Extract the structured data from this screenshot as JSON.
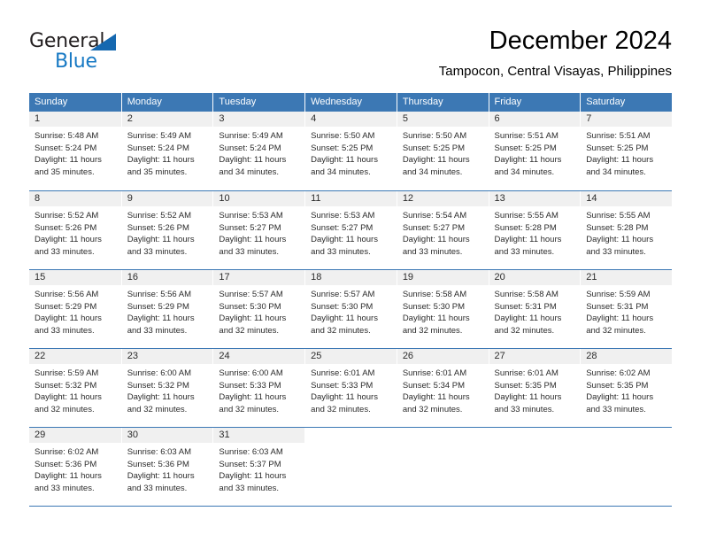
{
  "logo": {
    "text_top": "General",
    "text_bottom": "Blue",
    "triangle_color": "#1568b0",
    "blue_color": "#1779c4"
  },
  "header": {
    "title": "December 2024",
    "subtitle": "Tampocon, Central Visayas, Philippines"
  },
  "theme": {
    "header_bg": "#3c78b4",
    "header_text": "#ffffff",
    "daynum_band_bg": "#f0f0f0",
    "cell_bg": "#ffffff",
    "grid_line": "#3c78b4"
  },
  "weekdays": [
    "Sunday",
    "Monday",
    "Tuesday",
    "Wednesday",
    "Thursday",
    "Friday",
    "Saturday"
  ],
  "weeks": [
    {
      "days": [
        {
          "num": "1",
          "sunrise": "Sunrise: 5:48 AM",
          "sunset": "Sunset: 5:24 PM",
          "daylight": "Daylight: 11 hours and 35 minutes."
        },
        {
          "num": "2",
          "sunrise": "Sunrise: 5:49 AM",
          "sunset": "Sunset: 5:24 PM",
          "daylight": "Daylight: 11 hours and 35 minutes."
        },
        {
          "num": "3",
          "sunrise": "Sunrise: 5:49 AM",
          "sunset": "Sunset: 5:24 PM",
          "daylight": "Daylight: 11 hours and 34 minutes."
        },
        {
          "num": "4",
          "sunrise": "Sunrise: 5:50 AM",
          "sunset": "Sunset: 5:25 PM",
          "daylight": "Daylight: 11 hours and 34 minutes."
        },
        {
          "num": "5",
          "sunrise": "Sunrise: 5:50 AM",
          "sunset": "Sunset: 5:25 PM",
          "daylight": "Daylight: 11 hours and 34 minutes."
        },
        {
          "num": "6",
          "sunrise": "Sunrise: 5:51 AM",
          "sunset": "Sunset: 5:25 PM",
          "daylight": "Daylight: 11 hours and 34 minutes."
        },
        {
          "num": "7",
          "sunrise": "Sunrise: 5:51 AM",
          "sunset": "Sunset: 5:25 PM",
          "daylight": "Daylight: 11 hours and 34 minutes."
        }
      ]
    },
    {
      "days": [
        {
          "num": "8",
          "sunrise": "Sunrise: 5:52 AM",
          "sunset": "Sunset: 5:26 PM",
          "daylight": "Daylight: 11 hours and 33 minutes."
        },
        {
          "num": "9",
          "sunrise": "Sunrise: 5:52 AM",
          "sunset": "Sunset: 5:26 PM",
          "daylight": "Daylight: 11 hours and 33 minutes."
        },
        {
          "num": "10",
          "sunrise": "Sunrise: 5:53 AM",
          "sunset": "Sunset: 5:27 PM",
          "daylight": "Daylight: 11 hours and 33 minutes."
        },
        {
          "num": "11",
          "sunrise": "Sunrise: 5:53 AM",
          "sunset": "Sunset: 5:27 PM",
          "daylight": "Daylight: 11 hours and 33 minutes."
        },
        {
          "num": "12",
          "sunrise": "Sunrise: 5:54 AM",
          "sunset": "Sunset: 5:27 PM",
          "daylight": "Daylight: 11 hours and 33 minutes."
        },
        {
          "num": "13",
          "sunrise": "Sunrise: 5:55 AM",
          "sunset": "Sunset: 5:28 PM",
          "daylight": "Daylight: 11 hours and 33 minutes."
        },
        {
          "num": "14",
          "sunrise": "Sunrise: 5:55 AM",
          "sunset": "Sunset: 5:28 PM",
          "daylight": "Daylight: 11 hours and 33 minutes."
        }
      ]
    },
    {
      "days": [
        {
          "num": "15",
          "sunrise": "Sunrise: 5:56 AM",
          "sunset": "Sunset: 5:29 PM",
          "daylight": "Daylight: 11 hours and 33 minutes."
        },
        {
          "num": "16",
          "sunrise": "Sunrise: 5:56 AM",
          "sunset": "Sunset: 5:29 PM",
          "daylight": "Daylight: 11 hours and 33 minutes."
        },
        {
          "num": "17",
          "sunrise": "Sunrise: 5:57 AM",
          "sunset": "Sunset: 5:30 PM",
          "daylight": "Daylight: 11 hours and 32 minutes."
        },
        {
          "num": "18",
          "sunrise": "Sunrise: 5:57 AM",
          "sunset": "Sunset: 5:30 PM",
          "daylight": "Daylight: 11 hours and 32 minutes."
        },
        {
          "num": "19",
          "sunrise": "Sunrise: 5:58 AM",
          "sunset": "Sunset: 5:30 PM",
          "daylight": "Daylight: 11 hours and 32 minutes."
        },
        {
          "num": "20",
          "sunrise": "Sunrise: 5:58 AM",
          "sunset": "Sunset: 5:31 PM",
          "daylight": "Daylight: 11 hours and 32 minutes."
        },
        {
          "num": "21",
          "sunrise": "Sunrise: 5:59 AM",
          "sunset": "Sunset: 5:31 PM",
          "daylight": "Daylight: 11 hours and 32 minutes."
        }
      ]
    },
    {
      "days": [
        {
          "num": "22",
          "sunrise": "Sunrise: 5:59 AM",
          "sunset": "Sunset: 5:32 PM",
          "daylight": "Daylight: 11 hours and 32 minutes."
        },
        {
          "num": "23",
          "sunrise": "Sunrise: 6:00 AM",
          "sunset": "Sunset: 5:32 PM",
          "daylight": "Daylight: 11 hours and 32 minutes."
        },
        {
          "num": "24",
          "sunrise": "Sunrise: 6:00 AM",
          "sunset": "Sunset: 5:33 PM",
          "daylight": "Daylight: 11 hours and 32 minutes."
        },
        {
          "num": "25",
          "sunrise": "Sunrise: 6:01 AM",
          "sunset": "Sunset: 5:33 PM",
          "daylight": "Daylight: 11 hours and 32 minutes."
        },
        {
          "num": "26",
          "sunrise": "Sunrise: 6:01 AM",
          "sunset": "Sunset: 5:34 PM",
          "daylight": "Daylight: 11 hours and 32 minutes."
        },
        {
          "num": "27",
          "sunrise": "Sunrise: 6:01 AM",
          "sunset": "Sunset: 5:35 PM",
          "daylight": "Daylight: 11 hours and 33 minutes."
        },
        {
          "num": "28",
          "sunrise": "Sunrise: 6:02 AM",
          "sunset": "Sunset: 5:35 PM",
          "daylight": "Daylight: 11 hours and 33 minutes."
        }
      ]
    },
    {
      "days": [
        {
          "num": "29",
          "sunrise": "Sunrise: 6:02 AM",
          "sunset": "Sunset: 5:36 PM",
          "daylight": "Daylight: 11 hours and 33 minutes."
        },
        {
          "num": "30",
          "sunrise": "Sunrise: 6:03 AM",
          "sunset": "Sunset: 5:36 PM",
          "daylight": "Daylight: 11 hours and 33 minutes."
        },
        {
          "num": "31",
          "sunrise": "Sunrise: 6:03 AM",
          "sunset": "Sunset: 5:37 PM",
          "daylight": "Daylight: 11 hours and 33 minutes."
        },
        {
          "num": "",
          "sunrise": "",
          "sunset": "",
          "daylight": ""
        },
        {
          "num": "",
          "sunrise": "",
          "sunset": "",
          "daylight": ""
        },
        {
          "num": "",
          "sunrise": "",
          "sunset": "",
          "daylight": ""
        },
        {
          "num": "",
          "sunrise": "",
          "sunset": "",
          "daylight": ""
        }
      ]
    }
  ]
}
